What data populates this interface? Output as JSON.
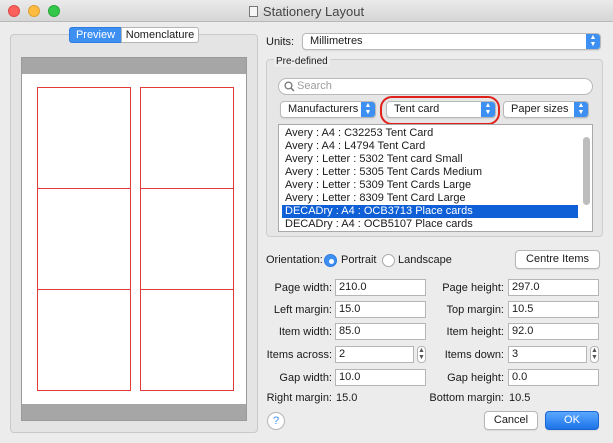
{
  "window": {
    "title": "Stationery Layout"
  },
  "preview_tabs": [
    {
      "label": "Preview",
      "selected": true
    },
    {
      "label": "Nomenclature",
      "selected": false
    }
  ],
  "units": {
    "label": "Units:",
    "value": "Millimetres"
  },
  "predefined": {
    "label": "Pre-defined",
    "search_placeholder": "Search",
    "filters": [
      {
        "value": "Manufacturers"
      },
      {
        "value": "Tent card"
      },
      {
        "value": "Paper sizes"
      }
    ],
    "items": [
      {
        "label": "Avery : A4 : C32253 Tent Card",
        "selected": false
      },
      {
        "label": "Avery : A4 : L4794 Tent Card",
        "selected": false
      },
      {
        "label": "Avery : Letter : 5302 Tent card Small",
        "selected": false
      },
      {
        "label": "Avery : Letter : 5305 Tent Cards Medium",
        "selected": false
      },
      {
        "label": "Avery : Letter : 5309 Tent Cards Large",
        "selected": false
      },
      {
        "label": "Avery : Letter : 8309 Tent Card Large",
        "selected": false
      },
      {
        "label": "DECADry : A4 : OCB3713 Place cards",
        "selected": true
      },
      {
        "label": "DECADry : A4 : OCB5107 Place cards",
        "selected": false
      }
    ]
  },
  "orientation": {
    "label": "Orientation:",
    "portrait": "Portrait",
    "landscape": "Landscape",
    "selected": "Portrait"
  },
  "centre_items_label": "Centre Items",
  "fields": {
    "page_width": {
      "label": "Page width:",
      "value": "210.0"
    },
    "page_height": {
      "label": "Page height:",
      "value": "297.0"
    },
    "left_margin": {
      "label": "Left margin:",
      "value": "15.0"
    },
    "top_margin": {
      "label": "Top margin:",
      "value": "10.5"
    },
    "item_width": {
      "label": "Item width:",
      "value": "85.0"
    },
    "item_height": {
      "label": "Item height:",
      "value": "92.0"
    },
    "items_across": {
      "label": "Items across:",
      "value": "2"
    },
    "items_down": {
      "label": "Items down:",
      "value": "3"
    },
    "gap_width": {
      "label": "Gap width:",
      "value": "10.0"
    },
    "gap_height": {
      "label": "Gap height:",
      "value": "0.0"
    }
  },
  "computed": {
    "right_margin": {
      "label": "Right margin:",
      "value": "15.0"
    },
    "bottom_margin": {
      "label": "Bottom margin:",
      "value": "10.5"
    }
  },
  "buttons": {
    "help": "?",
    "cancel": "Cancel",
    "ok": "OK"
  },
  "colors": {
    "accent": "#3d8ff2",
    "selection": "#0f5fd6",
    "card_outline": "#e13a3a",
    "highlight_ring": "#e0201a"
  }
}
